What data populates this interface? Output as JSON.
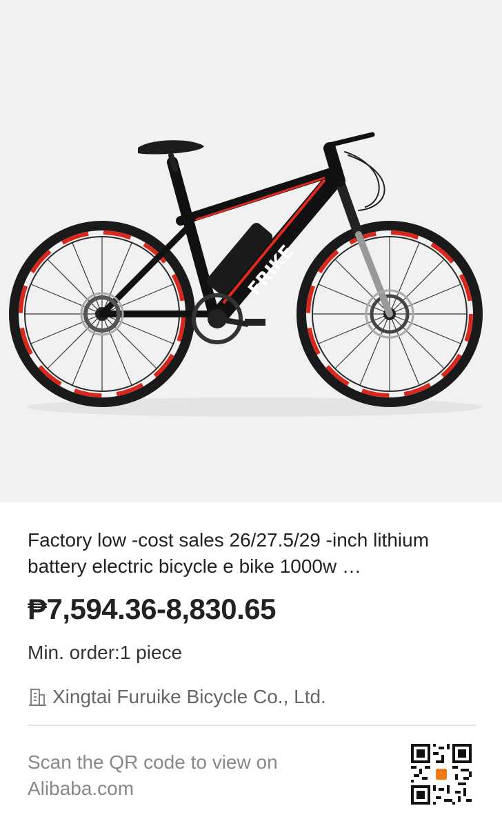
{
  "product": {
    "image_alt": "Black and red mountain electric bicycle",
    "frame_brand": "FRIKE",
    "title": "Factory low -cost sales 26/27.5/29 -inch lithium battery electric bicycle e bike 1000w …",
    "price": "₱7,594.36-8,830.65",
    "min_order": "Min. order:1 piece",
    "supplier_icon": "building-icon",
    "supplier": "Xingtai Furuike Bicycle Co., Ltd."
  },
  "footer": {
    "scan_text": "Scan the QR code to view on Alibaba.com",
    "qr_icon": "qr-code-icon",
    "qr_accent": "#f07a1a"
  },
  "colors": {
    "hero_bg": "#f1f1f1",
    "frame": "#111111",
    "accent_red": "#e02a1f",
    "text_primary": "#222222",
    "text_muted": "#888888",
    "divider": "#e3e3e3"
  }
}
